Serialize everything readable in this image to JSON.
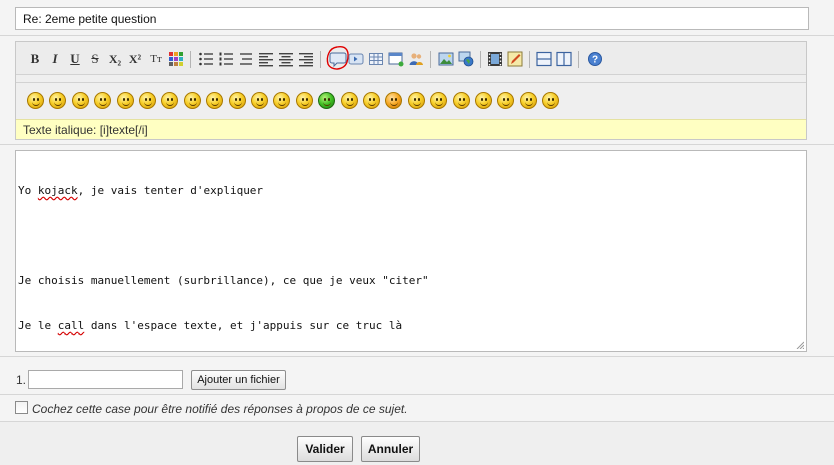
{
  "subject": {
    "value": "Re: 2eme petite question"
  },
  "toolbar": {
    "format_buttons": [
      {
        "name": "bold-button",
        "glyph": "B"
      },
      {
        "name": "italic-button",
        "glyph": "I"
      },
      {
        "name": "underline-button",
        "glyph": "U"
      },
      {
        "name": "strikethrough-button",
        "glyph": "S"
      },
      {
        "name": "subscript-button",
        "glyph": "X₂"
      },
      {
        "name": "superscript-button",
        "glyph": "X²"
      },
      {
        "name": "font-size-button",
        "glyph": "Tт"
      }
    ],
    "icons": [
      "color-palette-icon",
      "bulleted-list-icon",
      "numbered-list-icon",
      "list-icon",
      "align-left-icon",
      "align-center-icon",
      "align-right-icon",
      "quote-bubble-icon",
      "code-icon",
      "table-icon",
      "insert-window-icon",
      "users-icon",
      "image-icon",
      "web-image-icon",
      "video-icon",
      "pencil-drawing-icon",
      "horizontal-split-icon",
      "vertical-split-icon",
      "help-icon"
    ],
    "highlight_color": "#e00000"
  },
  "smileys": [
    "smiley-cool-icon",
    "smiley-sad-icon",
    "smiley-smile-icon",
    "smiley-grin-icon",
    "smiley-happy-icon",
    "smiley-wink-icon",
    "smiley-tongue-icon",
    "smiley-angry-icon",
    "smiley-confused-icon",
    "smiley-surprised-icon",
    "smiley-shocked-icon",
    "smiley-rolleyes-icon",
    "smiley-laugh-icon",
    "smiley-sick-icon",
    "smiley-crying-icon",
    "smiley-sleepy-icon",
    "smiley-blush-icon",
    "smiley-kiss-icon",
    "smiley-crazy-icon",
    "smiley-neutral-icon",
    "smiley-dizzy-icon",
    "smiley-devil-icon",
    "smiley-evil-icon",
    "smiley-dead-icon"
  ],
  "hint": {
    "text": "Texte italique: [i]texte[/i]"
  },
  "message": {
    "line1_a": "Yo ",
    "line1_b": "kojack",
    "line1_c": ", je vais tenter d'expliquer",
    "line2": "",
    "line3": "Je choisis manuellement (surbrillance), ce que je veux \"citer\"",
    "line4_a": "Je le ",
    "line4_b": "call",
    "line4_c": " dans l'espace texte, et j'appuis sur ce truc là"
  },
  "attachment": {
    "number": "1.",
    "button_label": "Ajouter un fichier"
  },
  "notify": {
    "label": "Cochez cette case pour être notifié des réponses à propos de ce sujet."
  },
  "actions": {
    "submit_label": "Valider",
    "cancel_label": "Annuler"
  }
}
